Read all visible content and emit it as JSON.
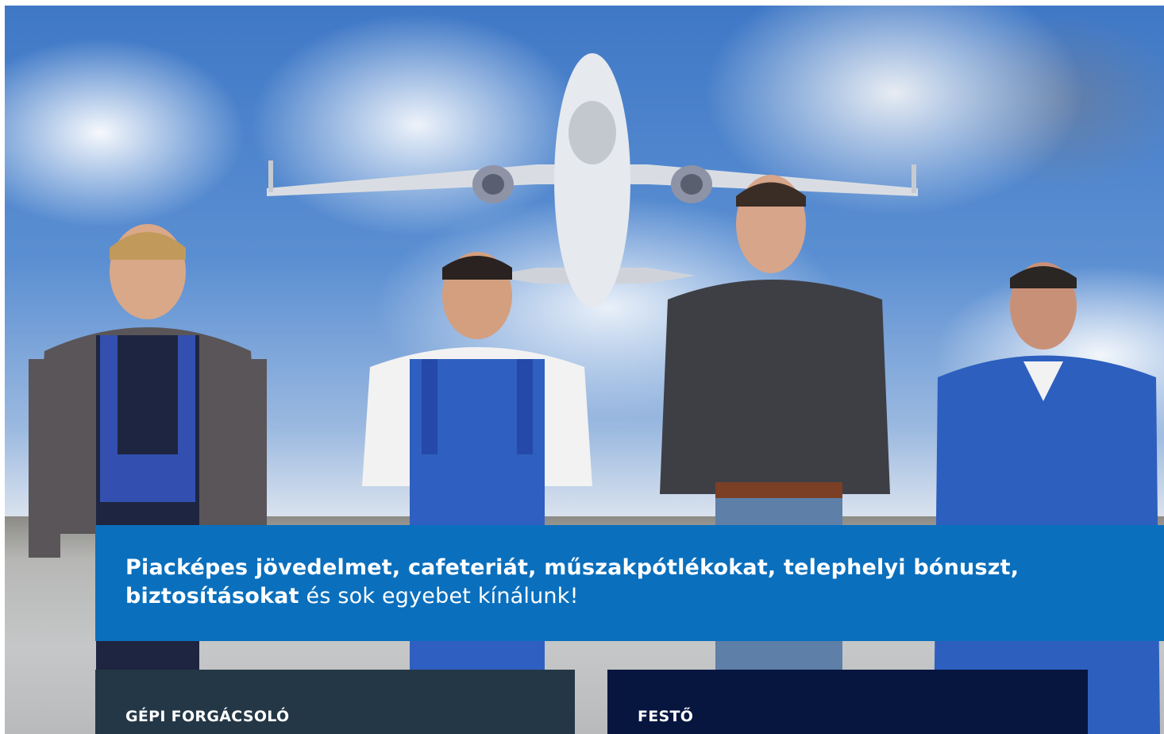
{
  "banner": {
    "bold_text": "Piacképes jövedelmet, cafeteriát, műszakpótlékokat, telephelyi bónuszt, biztosításokat",
    "regular_text": " és sok egyebet kínálunk!"
  },
  "jobs": [
    {
      "title": "GÉPI FORGÁCSOLÓ"
    },
    {
      "title": "FESTŐ"
    }
  ],
  "colors": {
    "banner_blue": "#0a6fbd",
    "card_slate": "#243746",
    "card_navy": "#06163f"
  }
}
